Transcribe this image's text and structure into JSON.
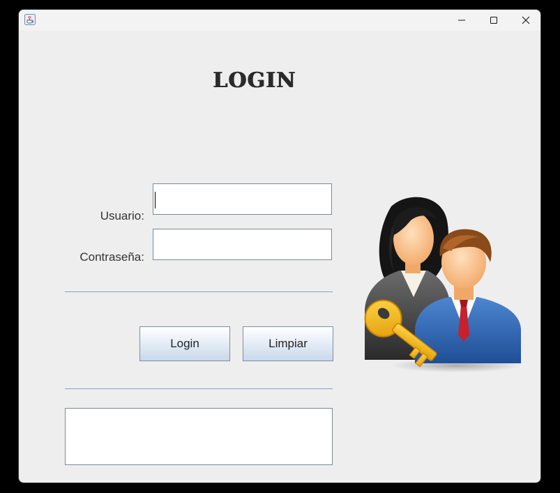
{
  "window": {
    "icon": "java-coffee-cup-icon",
    "controls": {
      "minimize": "minimize-icon",
      "maximize": "maximize-icon",
      "close": "close-icon"
    }
  },
  "form": {
    "title": "LOGIN",
    "username_label": "Usuario:",
    "password_label": "Contraseña:",
    "username_value": "",
    "password_value": "",
    "login_button": "Login",
    "clear_button": "Limpiar",
    "output_text": ""
  },
  "illustration": {
    "icon": "users-with-key-icon"
  },
  "colors": {
    "window_background": "#eeeeee",
    "separator": "#8aa0bd",
    "button_gradient_top": "#ffffff",
    "button_gradient_bottom": "#c9d8ea"
  }
}
